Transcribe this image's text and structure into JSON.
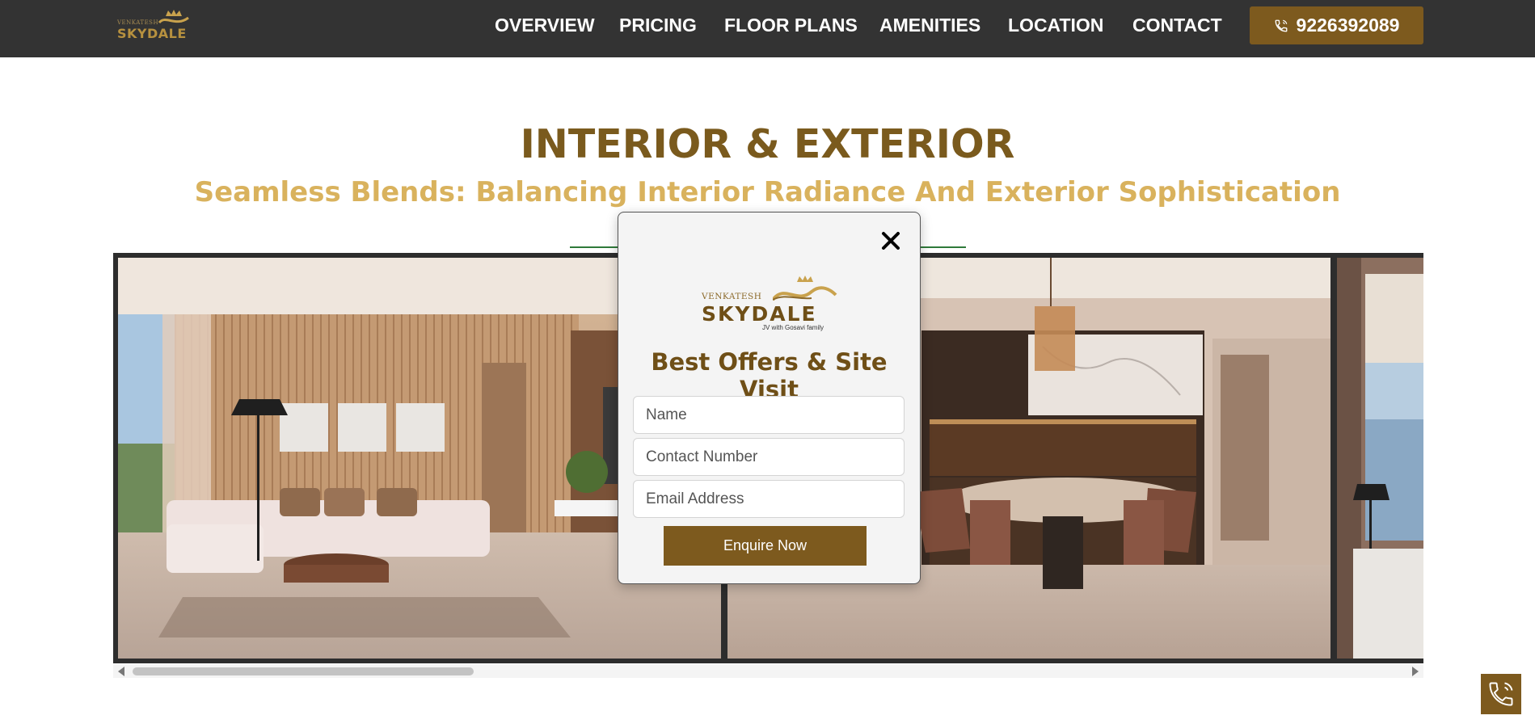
{
  "logo": {
    "small": "VENKATESH",
    "big": "SKYDALE"
  },
  "nav": {
    "items": [
      "OVERVIEW",
      "PRICING",
      "FLOOR PLANS",
      "AMENITIES",
      "LOCATION",
      "CONTACT"
    ],
    "phone": "9226392089"
  },
  "section": {
    "title": "INTERIOR & EXTERIOR",
    "subtitle": "Seamless Blends: Balancing Interior Radiance And Exterior Sophistication"
  },
  "modal": {
    "logo_small": "VENKATESH",
    "logo_big": "SKYDALE",
    "logo_tagline": "JV with Gosavi family",
    "title": "Best Offers & Site Visit",
    "name_placeholder": "Name",
    "contact_placeholder": "Contact Number",
    "email_placeholder": "Email Address",
    "button": "Enquire Now"
  },
  "colors": {
    "brand": "#7d5a1e",
    "gold": "#d9b25d",
    "nav_bg": "#333333"
  },
  "icons": [
    "phone-icon",
    "close-icon",
    "crown-icon"
  ]
}
